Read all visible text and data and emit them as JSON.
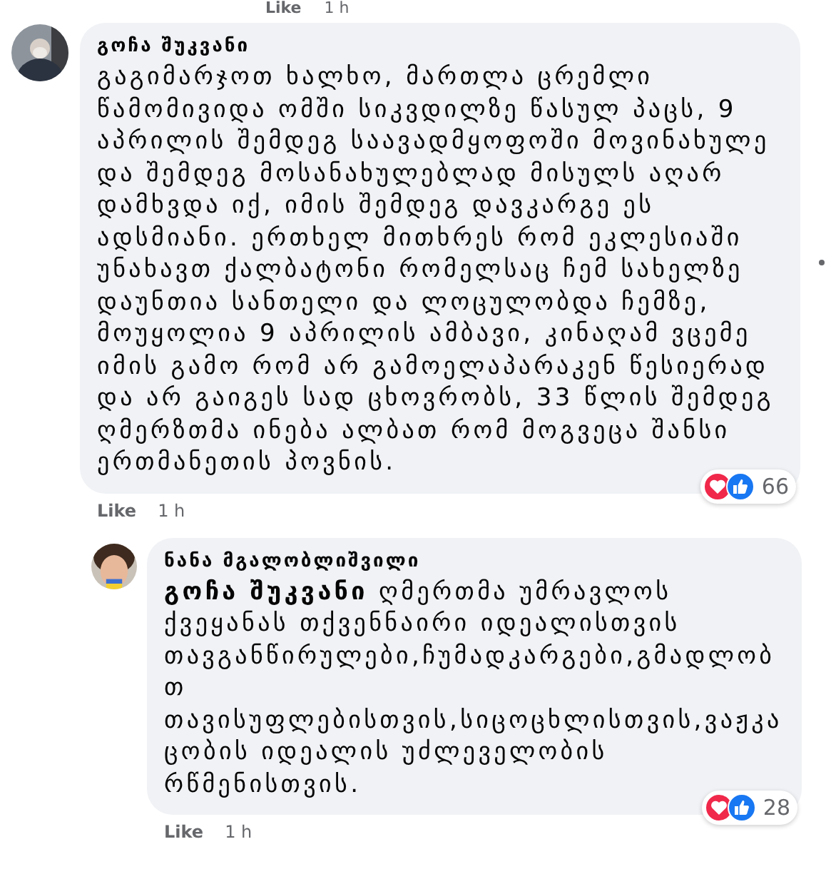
{
  "top_actions": {
    "like": "Like",
    "time": "1 h"
  },
  "comments": [
    {
      "reply": false,
      "author": "გოჩა შუკვანი",
      "text": "გაგიმარჯოთ ხალხო, მართლა ცრემლი წამომივიდა ომში სიკვდილზე წასულ პაცს, 9 აპრილის შემდეგ საავადმყოფოში მოვინახულე და შემდეგ მოსანახულებლად მისულს აღარ დამხვდა იქ, იმის შემდეგ დავკარგე ეს ადსმიანი. ერთხელ მითხრეს რომ ეკლესიაში უნახავთ ქალბატონი რომელსაც ჩემ სახელზე დაუნთია სანთელი და ლოცულობდა ჩემზე, მოუყოლია 9 აპრილის ამბავი, კინაღამ ვცემე იმის გამო რომ არ გამოელაპარაკენ წესიერად და არ გაიგეს სად ცხოვრობს, 33 წლის შემდეგ ღმერზთმა ინება ალბათ რომ მოგვეცა შანსი ერთმანეთის პოვნის.",
      "like": "Like",
      "time": "1 h",
      "reactions": [
        {
          "kind": "love"
        },
        {
          "kind": "like"
        }
      ],
      "count": "66"
    },
    {
      "reply": true,
      "author": "ნანა მგალობლიშვილი",
      "text": "**გოჩა შუკვანი** ღმერთმა უმრავლოს ქვეყანას თქვენნაირი იდეალისთვის თავგანწირულები,ჩუმადკარგები,გმადლობთ თავისუფლებისთვის,სიცოცხლისთვის,ვაჟკაცობის იდეალის უძლეველობის რწმენისთვის.",
      "like": "Like",
      "time": "1 h",
      "reactions": [
        {
          "kind": "love"
        },
        {
          "kind": "like"
        }
      ],
      "count": "28"
    }
  ]
}
